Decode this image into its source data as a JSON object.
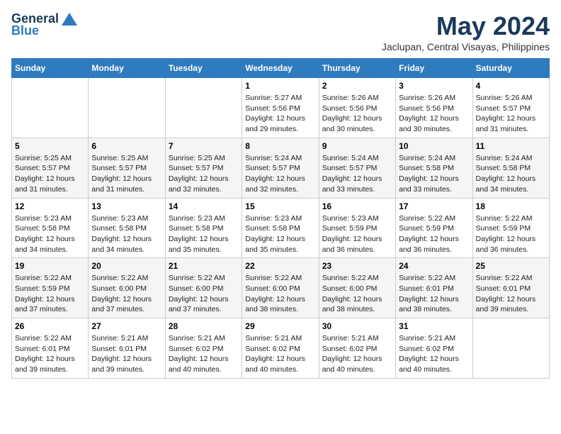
{
  "logo": {
    "general": "General",
    "blue": "Blue"
  },
  "title": {
    "month": "May 2024",
    "location": "Jaclupan, Central Visayas, Philippines"
  },
  "weekdays": [
    "Sunday",
    "Monday",
    "Tuesday",
    "Wednesday",
    "Thursday",
    "Friday",
    "Saturday"
  ],
  "weeks": [
    [
      {
        "day": "",
        "sunrise": "",
        "sunset": "",
        "daylight": ""
      },
      {
        "day": "",
        "sunrise": "",
        "sunset": "",
        "daylight": ""
      },
      {
        "day": "",
        "sunrise": "",
        "sunset": "",
        "daylight": ""
      },
      {
        "day": "1",
        "sunrise": "Sunrise: 5:27 AM",
        "sunset": "Sunset: 5:56 PM",
        "daylight": "Daylight: 12 hours and 29 minutes."
      },
      {
        "day": "2",
        "sunrise": "Sunrise: 5:26 AM",
        "sunset": "Sunset: 5:56 PM",
        "daylight": "Daylight: 12 hours and 30 minutes."
      },
      {
        "day": "3",
        "sunrise": "Sunrise: 5:26 AM",
        "sunset": "Sunset: 5:56 PM",
        "daylight": "Daylight: 12 hours and 30 minutes."
      },
      {
        "day": "4",
        "sunrise": "Sunrise: 5:26 AM",
        "sunset": "Sunset: 5:57 PM",
        "daylight": "Daylight: 12 hours and 31 minutes."
      }
    ],
    [
      {
        "day": "5",
        "sunrise": "Sunrise: 5:25 AM",
        "sunset": "Sunset: 5:57 PM",
        "daylight": "Daylight: 12 hours and 31 minutes."
      },
      {
        "day": "6",
        "sunrise": "Sunrise: 5:25 AM",
        "sunset": "Sunset: 5:57 PM",
        "daylight": "Daylight: 12 hours and 31 minutes."
      },
      {
        "day": "7",
        "sunrise": "Sunrise: 5:25 AM",
        "sunset": "Sunset: 5:57 PM",
        "daylight": "Daylight: 12 hours and 32 minutes."
      },
      {
        "day": "8",
        "sunrise": "Sunrise: 5:24 AM",
        "sunset": "Sunset: 5:57 PM",
        "daylight": "Daylight: 12 hours and 32 minutes."
      },
      {
        "day": "9",
        "sunrise": "Sunrise: 5:24 AM",
        "sunset": "Sunset: 5:57 PM",
        "daylight": "Daylight: 12 hours and 33 minutes."
      },
      {
        "day": "10",
        "sunrise": "Sunrise: 5:24 AM",
        "sunset": "Sunset: 5:58 PM",
        "daylight": "Daylight: 12 hours and 33 minutes."
      },
      {
        "day": "11",
        "sunrise": "Sunrise: 5:24 AM",
        "sunset": "Sunset: 5:58 PM",
        "daylight": "Daylight: 12 hours and 34 minutes."
      }
    ],
    [
      {
        "day": "12",
        "sunrise": "Sunrise: 5:23 AM",
        "sunset": "Sunset: 5:58 PM",
        "daylight": "Daylight: 12 hours and 34 minutes."
      },
      {
        "day": "13",
        "sunrise": "Sunrise: 5:23 AM",
        "sunset": "Sunset: 5:58 PM",
        "daylight": "Daylight: 12 hours and 34 minutes."
      },
      {
        "day": "14",
        "sunrise": "Sunrise: 5:23 AM",
        "sunset": "Sunset: 5:58 PM",
        "daylight": "Daylight: 12 hours and 35 minutes."
      },
      {
        "day": "15",
        "sunrise": "Sunrise: 5:23 AM",
        "sunset": "Sunset: 5:58 PM",
        "daylight": "Daylight: 12 hours and 35 minutes."
      },
      {
        "day": "16",
        "sunrise": "Sunrise: 5:23 AM",
        "sunset": "Sunset: 5:59 PM",
        "daylight": "Daylight: 12 hours and 36 minutes."
      },
      {
        "day": "17",
        "sunrise": "Sunrise: 5:22 AM",
        "sunset": "Sunset: 5:59 PM",
        "daylight": "Daylight: 12 hours and 36 minutes."
      },
      {
        "day": "18",
        "sunrise": "Sunrise: 5:22 AM",
        "sunset": "Sunset: 5:59 PM",
        "daylight": "Daylight: 12 hours and 36 minutes."
      }
    ],
    [
      {
        "day": "19",
        "sunrise": "Sunrise: 5:22 AM",
        "sunset": "Sunset: 5:59 PM",
        "daylight": "Daylight: 12 hours and 37 minutes."
      },
      {
        "day": "20",
        "sunrise": "Sunrise: 5:22 AM",
        "sunset": "Sunset: 6:00 PM",
        "daylight": "Daylight: 12 hours and 37 minutes."
      },
      {
        "day": "21",
        "sunrise": "Sunrise: 5:22 AM",
        "sunset": "Sunset: 6:00 PM",
        "daylight": "Daylight: 12 hours and 37 minutes."
      },
      {
        "day": "22",
        "sunrise": "Sunrise: 5:22 AM",
        "sunset": "Sunset: 6:00 PM",
        "daylight": "Daylight: 12 hours and 38 minutes."
      },
      {
        "day": "23",
        "sunrise": "Sunrise: 5:22 AM",
        "sunset": "Sunset: 6:00 PM",
        "daylight": "Daylight: 12 hours and 38 minutes."
      },
      {
        "day": "24",
        "sunrise": "Sunrise: 5:22 AM",
        "sunset": "Sunset: 6:01 PM",
        "daylight": "Daylight: 12 hours and 38 minutes."
      },
      {
        "day": "25",
        "sunrise": "Sunrise: 5:22 AM",
        "sunset": "Sunset: 6:01 PM",
        "daylight": "Daylight: 12 hours and 39 minutes."
      }
    ],
    [
      {
        "day": "26",
        "sunrise": "Sunrise: 5:22 AM",
        "sunset": "Sunset: 6:01 PM",
        "daylight": "Daylight: 12 hours and 39 minutes."
      },
      {
        "day": "27",
        "sunrise": "Sunrise: 5:21 AM",
        "sunset": "Sunset: 6:01 PM",
        "daylight": "Daylight: 12 hours and 39 minutes."
      },
      {
        "day": "28",
        "sunrise": "Sunrise: 5:21 AM",
        "sunset": "Sunset: 6:02 PM",
        "daylight": "Daylight: 12 hours and 40 minutes."
      },
      {
        "day": "29",
        "sunrise": "Sunrise: 5:21 AM",
        "sunset": "Sunset: 6:02 PM",
        "daylight": "Daylight: 12 hours and 40 minutes."
      },
      {
        "day": "30",
        "sunrise": "Sunrise: 5:21 AM",
        "sunset": "Sunset: 6:02 PM",
        "daylight": "Daylight: 12 hours and 40 minutes."
      },
      {
        "day": "31",
        "sunrise": "Sunrise: 5:21 AM",
        "sunset": "Sunset: 6:02 PM",
        "daylight": "Daylight: 12 hours and 40 minutes."
      },
      {
        "day": "",
        "sunrise": "",
        "sunset": "",
        "daylight": ""
      }
    ]
  ]
}
